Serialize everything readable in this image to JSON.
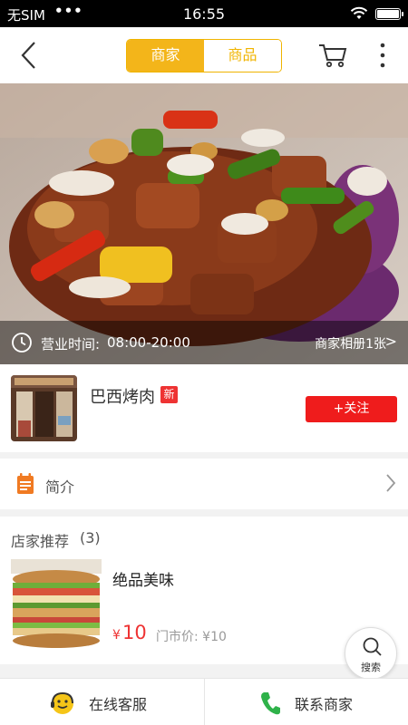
{
  "status_bar": {
    "carrier": "无SIM",
    "signal_dots": "•••",
    "time": "16:55"
  },
  "header": {
    "tabs": [
      {
        "label": "商家",
        "active": true
      },
      {
        "label": "商品",
        "active": false
      }
    ],
    "accent_color": "#f3b51a"
  },
  "hero": {
    "hours_label": "营业时间:",
    "hours_value": "08:00-20:00",
    "album_link": "商家相册1张",
    "album_chevron": ">"
  },
  "shop": {
    "name": "巴西烤肉",
    "badge": "新",
    "follow_label": "+关注",
    "follow_color": "#ef1c1c"
  },
  "intro": {
    "label": "简介"
  },
  "recommendations": {
    "title": "店家推荐",
    "count": "(3)",
    "items": [
      {
        "name": "绝品美味",
        "currency": "¥",
        "price": "10",
        "store_price": "门市价: ¥10"
      }
    ]
  },
  "search_fab": {
    "label": "搜索"
  },
  "bottom_bar": {
    "online_service_label": "在线客服",
    "contact_label": "联系商家"
  }
}
